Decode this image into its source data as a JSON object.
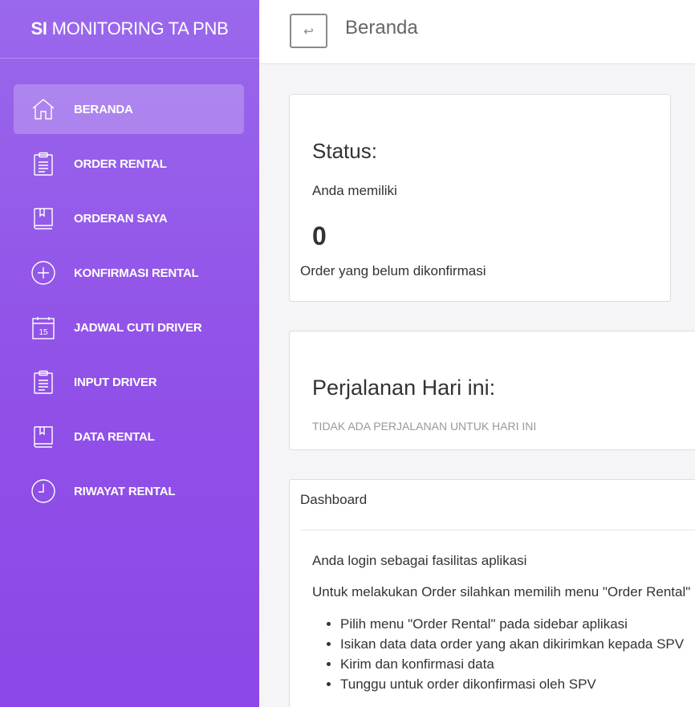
{
  "sidebar": {
    "brand_bold": "SI",
    "brand_rest": "MONITORING TA PNB",
    "items": [
      {
        "label": "BERANDA",
        "icon": "home-icon"
      },
      {
        "label": "ORDER RENTAL",
        "icon": "clipboard-icon"
      },
      {
        "label": "ORDERAN SAYA",
        "icon": "book-icon"
      },
      {
        "label": "KONFIRMASI RENTAL",
        "icon": "plus-circle-icon"
      },
      {
        "label": "JADWAL CUTI DRIVER",
        "icon": "calendar-icon"
      },
      {
        "label": "INPUT DRIVER",
        "icon": "clipboard-icon"
      },
      {
        "label": "DATA RENTAL",
        "icon": "book-icon"
      },
      {
        "label": "RIWAYAT RENTAL",
        "icon": "clock-icon"
      }
    ],
    "calendar_day": "15"
  },
  "header": {
    "back_glyph": "↩",
    "title": "Beranda"
  },
  "status_card": {
    "title": "Status:",
    "intro": "Anda memiliki",
    "count": "0",
    "caption": "Order yang belum dikonfirmasi"
  },
  "trip_card": {
    "title": "Perjalanan Hari ini:",
    "empty": "TIDAK ADA PERJALANAN UNTUK HARI INI"
  },
  "dashboard": {
    "header": "Dashboard",
    "line1": "Anda login sebagai fasilitas aplikasi",
    "line2": "Untuk melakukan Order silahkan memilih menu \"Order Rental\"",
    "steps": [
      "Pilih menu \"Order Rental\" pada sidebar aplikasi",
      "Isikan data data order yang akan dikirimkan kepada SPV",
      "Kirim dan konfirmasi data",
      "Tunggu untuk order dikonfirmasi oleh SPV"
    ]
  }
}
